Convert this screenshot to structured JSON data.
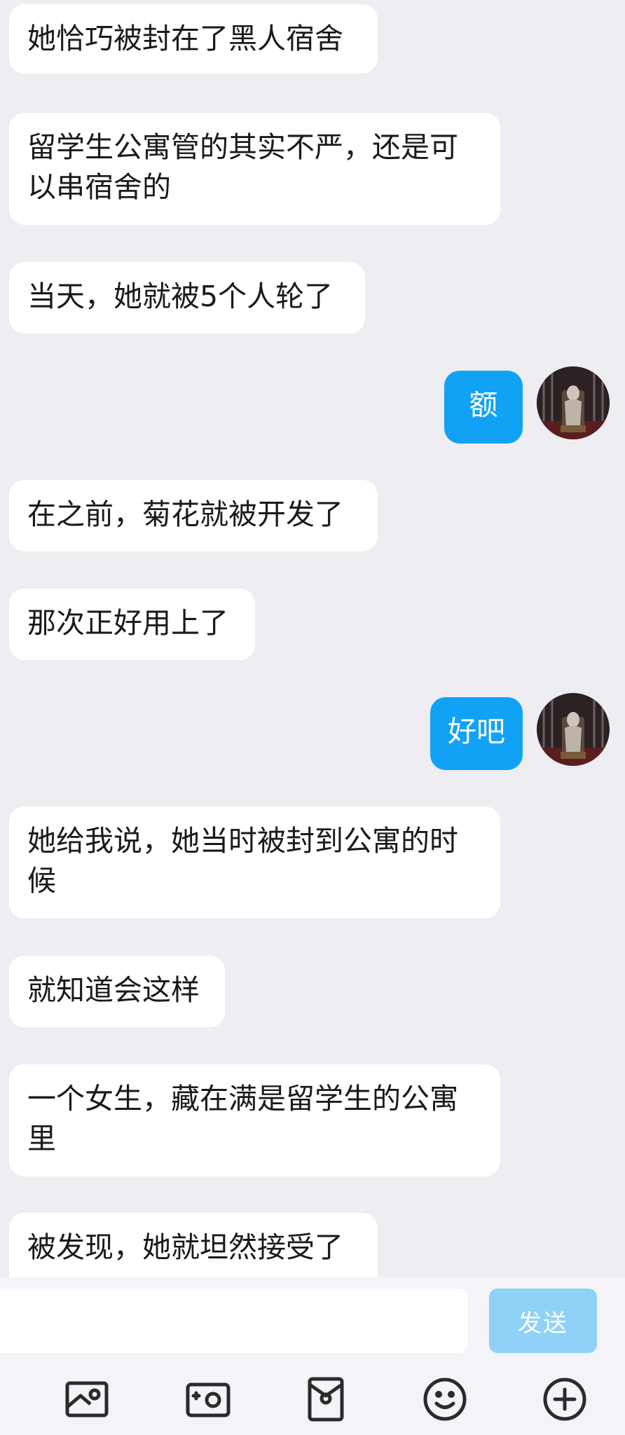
{
  "messages": [
    {
      "from": "other",
      "text": "她恰巧被封在了黑人宿舍"
    },
    {
      "from": "other",
      "text": "留学生公寓管的其实不严，还是可\n以串宿舍的"
    },
    {
      "from": "other",
      "text": "当天，她就被5个人轮了"
    },
    {
      "from": "me",
      "text": "额"
    },
    {
      "from": "other",
      "text": "在之前，菊花就被开发了"
    },
    {
      "from": "other",
      "text": "那次正好用上了"
    },
    {
      "from": "me",
      "text": "好吧"
    },
    {
      "from": "other",
      "text": "她给我说，她当时被封到公寓的时\n候"
    },
    {
      "from": "other",
      "text": "就知道会这样"
    },
    {
      "from": "other",
      "text": "一个女生，藏在满是留学生的公寓\n里"
    },
    {
      "from": "other",
      "text": "被发现，她就坦然接受了"
    }
  ],
  "input": {
    "value": "",
    "placeholder": ""
  },
  "send_label": "发送",
  "toolbar_icons": [
    "picture-icon",
    "camera-icon",
    "red-packet-icon",
    "emoji-icon",
    "plus-icon"
  ],
  "colors": {
    "background": "#ededf2",
    "my_bubble": "#12a2f5",
    "send_button_disabled": "#8fd1f7"
  }
}
